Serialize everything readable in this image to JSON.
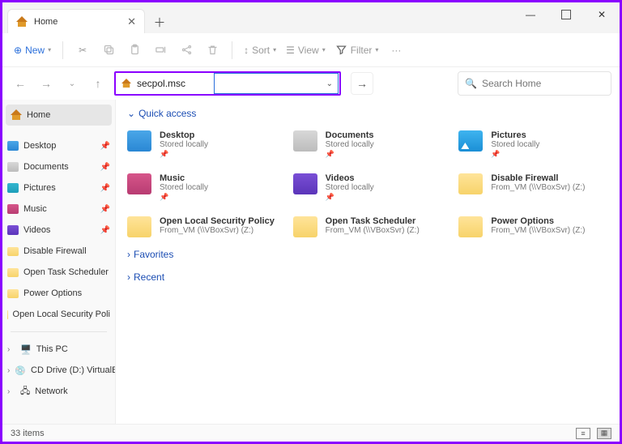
{
  "window": {
    "tab_title": "Home",
    "minimize": "—",
    "maximize": "☐",
    "close": "✕",
    "newtab": "＋",
    "tab_close": "✕"
  },
  "toolbar": {
    "new": "New",
    "sort": "Sort",
    "view": "View",
    "filter": "Filter",
    "more": "···"
  },
  "nav": {
    "back": "←",
    "forward": "→",
    "up": "↑",
    "recent_caret": "⌄",
    "go": "→",
    "address_value": "secpol.msc",
    "dropdown_caret": "⌄"
  },
  "search": {
    "placeholder": "Search Home"
  },
  "sidebar": {
    "home": "Home",
    "pinned": [
      {
        "label": "Desktop",
        "icon": "desktop"
      },
      {
        "label": "Documents",
        "icon": "documents"
      },
      {
        "label": "Pictures",
        "icon": "pictures"
      },
      {
        "label": "Music",
        "icon": "music"
      },
      {
        "label": "Videos",
        "icon": "videos"
      }
    ],
    "folders": [
      "Disable Firewall",
      "Open Task Scheduler",
      "Power Options",
      "Open Local Security Poli"
    ],
    "devices": [
      "This PC",
      "CD Drive (D:) VirtualBox",
      "Network"
    ]
  },
  "sections": {
    "quick_access": "Quick access",
    "favorites": "Favorites",
    "recent": "Recent"
  },
  "quick": [
    {
      "name": "Desktop",
      "sub": "Stored locally",
      "cls": "fld-blue",
      "pin": true
    },
    {
      "name": "Documents",
      "sub": "Stored locally",
      "cls": "fld-gray",
      "pin": true
    },
    {
      "name": "Pictures",
      "sub": "Stored locally",
      "cls": "fld-pic",
      "pin": true
    },
    {
      "name": "Music",
      "sub": "Stored locally",
      "cls": "fld-pink",
      "pin": true
    },
    {
      "name": "Videos",
      "sub": "Stored locally",
      "cls": "fld-purple",
      "pin": true
    },
    {
      "name": "Disable Firewall",
      "sub": "From_VM (\\\\VBoxSvr) (Z:)",
      "cls": "fld-yellow",
      "pin": false
    },
    {
      "name": "Open Local Security Policy",
      "sub": "From_VM (\\\\VBoxSvr) (Z:)",
      "cls": "fld-yellow",
      "pin": false
    },
    {
      "name": "Open Task Scheduler",
      "sub": "From_VM (\\\\VBoxSvr) (Z:)",
      "cls": "fld-yellow",
      "pin": false
    },
    {
      "name": "Power Options",
      "sub": "From_VM (\\\\VBoxSvr) (Z:)",
      "cls": "fld-yellow",
      "pin": false
    }
  ],
  "status": {
    "count": "33 items"
  },
  "colors": {
    "accent": "#2a6fdb",
    "highlight": "#8a00ff"
  }
}
